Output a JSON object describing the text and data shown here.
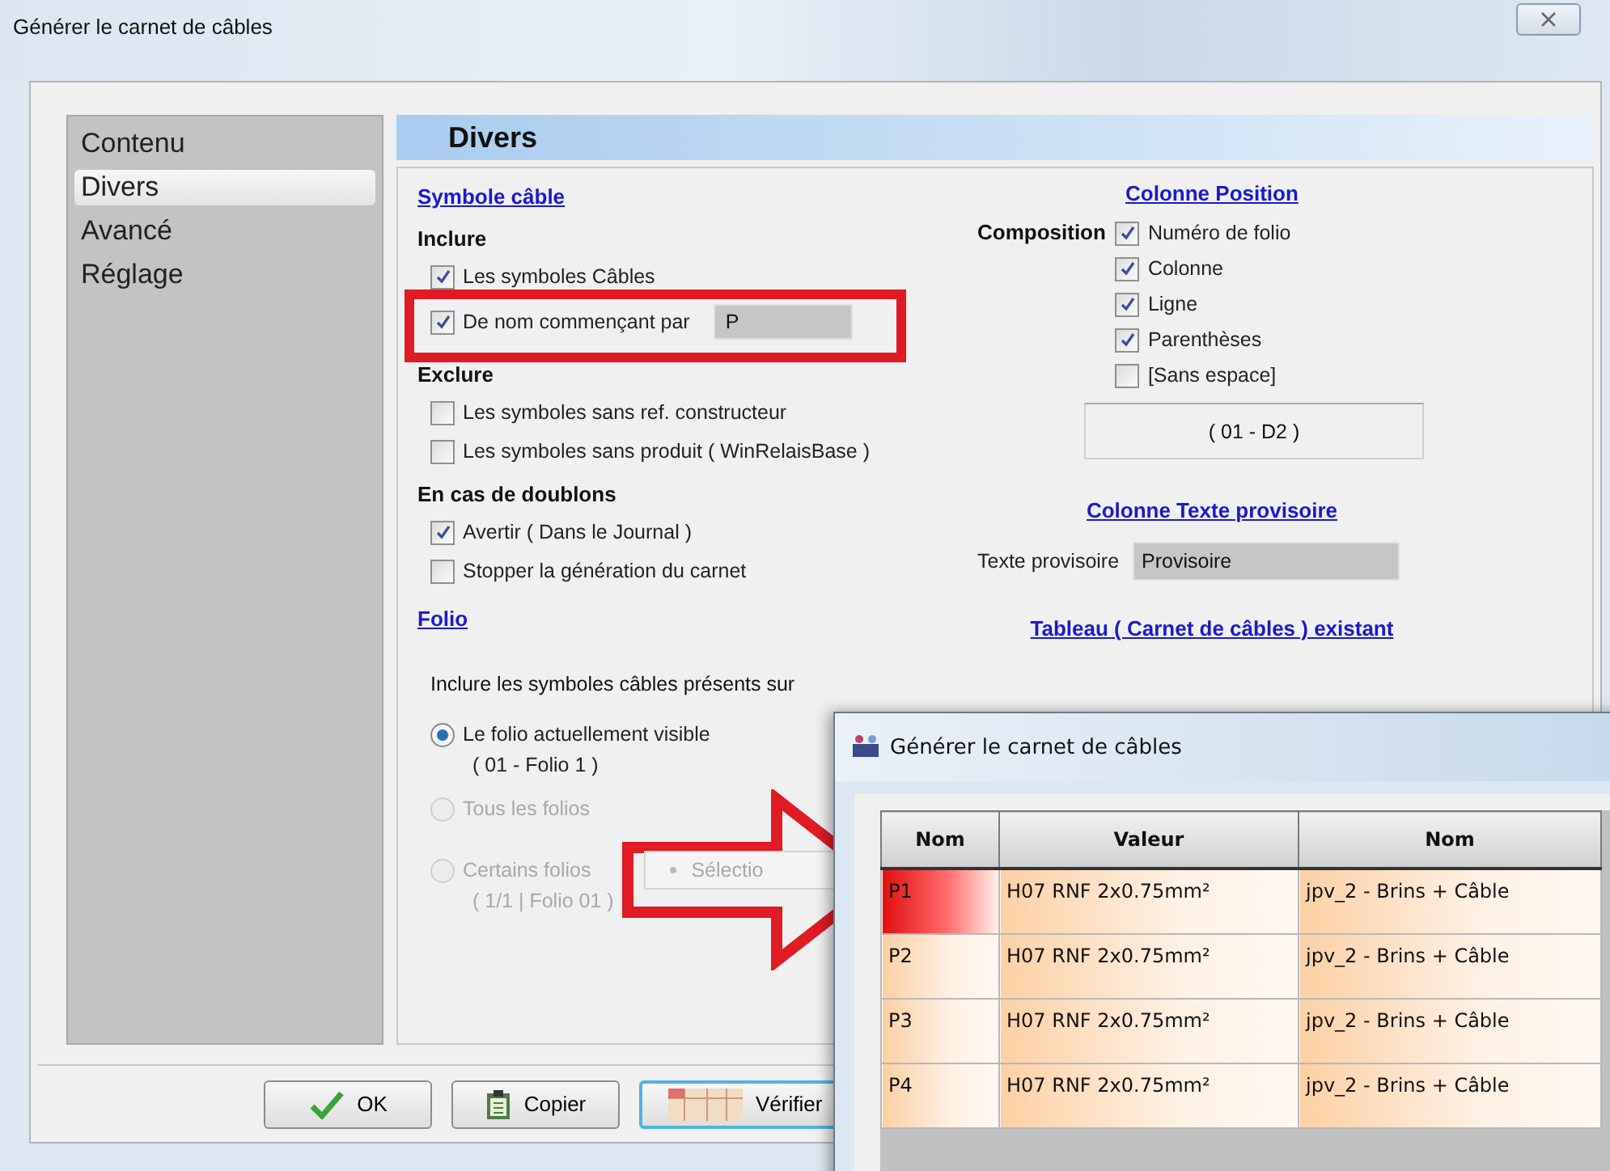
{
  "window": {
    "title": "Générer le carnet de câbles"
  },
  "sidebar": {
    "items": [
      {
        "label": "Contenu",
        "selected": false
      },
      {
        "label": "Divers",
        "selected": true
      },
      {
        "label": "Avancé",
        "selected": false
      },
      {
        "label": "Réglage",
        "selected": false
      }
    ]
  },
  "panel": {
    "title": "Divers",
    "left": [
      {
        "kind": "link",
        "label": "Symbole câble"
      },
      {
        "kind": "heading",
        "label": "Inclure"
      },
      {
        "kind": "checkbox",
        "label": "Les symboles Câbles",
        "checked": true
      },
      {
        "kind": "checkbox_field",
        "label": "De nom commençant par",
        "checked": true,
        "value": "P"
      },
      {
        "kind": "heading",
        "label": "Exclure"
      },
      {
        "kind": "checkbox",
        "label": "Les symboles sans ref. constructeur",
        "checked": false
      },
      {
        "kind": "checkbox",
        "label": "Les symboles sans produit ( WinRelaisBase )",
        "checked": false
      },
      {
        "kind": "heading",
        "label": "En cas de doublons"
      },
      {
        "kind": "checkbox",
        "label": "Avertir ( Dans le Journal )",
        "checked": true
      },
      {
        "kind": "checkbox",
        "label": "Stopper la génération du carnet",
        "checked": false
      },
      {
        "kind": "link",
        "label": "Folio"
      },
      {
        "kind": "text",
        "label": "Inclure les symboles câbles présents sur"
      },
      {
        "kind": "radio",
        "label": "Le folio actuellement visible",
        "note": "( 01 - Folio 1 )",
        "selected": true,
        "disabled": false
      },
      {
        "kind": "radio",
        "label": "Tous les folios",
        "selected": false,
        "disabled": true
      },
      {
        "kind": "radio",
        "label": "Certains folios",
        "note": "( 1/1  |  Folio 01 )",
        "button": "Sélectio",
        "selected": false,
        "disabled": true
      }
    ],
    "right": [
      {
        "kind": "link",
        "label": "Colonne Position"
      },
      {
        "kind": "composition",
        "label": "Composition",
        "options": [
          {
            "label": "Numéro de folio",
            "checked": true
          },
          {
            "label": "Colonne",
            "checked": true
          },
          {
            "label": "Ligne",
            "checked": true
          },
          {
            "label": "Parenthèses",
            "checked": true
          },
          {
            "label": "[Sans espace]",
            "checked": false
          }
        ]
      },
      {
        "kind": "preview",
        "label": "( 01 - D2 )"
      },
      {
        "kind": "link",
        "label": "Colonne Texte provisoire"
      },
      {
        "kind": "field",
        "label": "Texte provisoire",
        "value": "Provisoire"
      },
      {
        "kind": "link",
        "label": "Tableau ( Carnet de câbles ) existant"
      }
    ]
  },
  "buttons": [
    {
      "label": "OK",
      "focused": false
    },
    {
      "label": "Copier",
      "focused": false
    },
    {
      "label": "Vérifier",
      "focused": true
    }
  ],
  "popup": {
    "title": "Générer le carnet de câbles",
    "table": {
      "columns": [
        "Nom",
        "Valeur",
        "Nom"
      ],
      "rows": [
        {
          "cells": [
            "P1",
            "H07 RNF 2x0.75mm²",
            "jpv_2 - Brins + Câble"
          ],
          "highlighted": true
        },
        {
          "cells": [
            "P2",
            "H07 RNF 2x0.75mm²",
            "jpv_2 - Brins + Câble"
          ],
          "highlighted": false
        },
        {
          "cells": [
            "P3",
            "H07 RNF 2x0.75mm²",
            "jpv_2 - Brins + Câble"
          ],
          "highlighted": false
        },
        {
          "cells": [
            "P4",
            "H07 RNF 2x0.75mm²",
            "jpv_2 - Brins + Câble"
          ],
          "highlighted": false
        }
      ]
    }
  }
}
